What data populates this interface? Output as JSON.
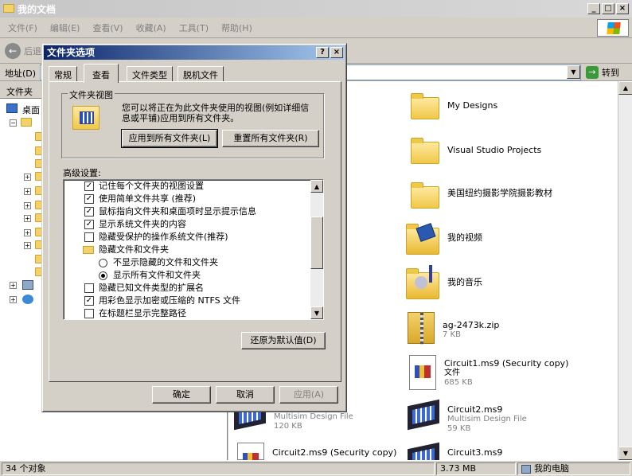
{
  "window": {
    "title": "我的文档"
  },
  "menu": [
    "文件(F)",
    "编辑(E)",
    "查看(V)",
    "收藏(A)",
    "工具(T)",
    "帮助(H)"
  ],
  "toolbar": {
    "back_label": "后退"
  },
  "address": {
    "label": "地址(D)",
    "go_label": "转到"
  },
  "folder_pane": {
    "title": "文件夹",
    "desktop_label": "桌面"
  },
  "files": [
    {
      "name": "My Designs",
      "type": "folder"
    },
    {
      "name": "Visual Studio Projects",
      "type": "folder"
    },
    {
      "name": "美国纽约摄影学院摄影教材",
      "type": "folder"
    },
    {
      "name": "我的视频",
      "type": "video-folder"
    },
    {
      "name": "我的音乐",
      "type": "music-folder"
    },
    {
      "name": "ag-2473k.zip",
      "sub1": "7 KB",
      "type": "zip"
    },
    {
      "name": "Circuit1.ms9 (Security copy)",
      "sub1": "文件",
      "sub2": "685 KB",
      "type": "doc"
    },
    {
      "name": "Circuit2.ms9",
      "sub1": "Multisim Design File",
      "sub2": "59 KB",
      "type": "chip"
    },
    {
      "name": "Circuit3.ms9",
      "type": "chip"
    },
    {
      "name": "",
      "sub1": "Multisim Design File",
      "sub2": "120 KB",
      "type": "chip"
    },
    {
      "name": "Circuit2.ms9 (Security copy)",
      "type": "doc"
    }
  ],
  "status": {
    "count": "34 个对象",
    "size": "3.73 MB",
    "location": "我的电脑"
  },
  "dialog": {
    "title": "文件夹选项",
    "tabs": [
      "常规",
      "查看",
      "文件类型",
      "脱机文件"
    ],
    "active_tab": "查看",
    "group_title": "文件夹视图",
    "group_text": "您可以将正在为此文件夹使用的视图(例如详细信息或平铺)应用到所有文件夹。",
    "apply_all_button": "应用到所有文件夹(L)",
    "reset_all_button": "重置所有文件夹(R)",
    "advanced_label": "高级设置:",
    "settings": [
      {
        "label": "记住每个文件夹的视图设置",
        "kind": "checkbox",
        "checked": true,
        "indent": 0
      },
      {
        "label": "使用简单文件共享 (推荐)",
        "kind": "checkbox",
        "checked": true,
        "indent": 0
      },
      {
        "label": "鼠标指向文件夹和桌面项时显示提示信息",
        "kind": "checkbox",
        "checked": true,
        "indent": 0
      },
      {
        "label": "显示系统文件夹的内容",
        "kind": "checkbox",
        "checked": true,
        "indent": 0
      },
      {
        "label": "隐藏受保护的操作系统文件(推荐)",
        "kind": "checkbox",
        "checked": false,
        "indent": 0
      },
      {
        "label": "隐藏文件和文件夹",
        "kind": "folder",
        "indent": 0
      },
      {
        "label": "不显示隐藏的文件和文件夹",
        "kind": "radio",
        "checked": false,
        "indent": 1
      },
      {
        "label": "显示所有文件和文件夹",
        "kind": "radio",
        "checked": true,
        "indent": 1
      },
      {
        "label": "隐藏已知文件类型的扩展名",
        "kind": "checkbox",
        "checked": false,
        "indent": 0
      },
      {
        "label": "用彩色显示加密或压缩的 NTFS 文件",
        "kind": "checkbox",
        "checked": true,
        "indent": 0
      },
      {
        "label": "在标题栏显示完整路径",
        "kind": "checkbox",
        "checked": false,
        "indent": 0
      }
    ],
    "restore_defaults_button": "还原为默认值(D)",
    "ok_button": "确定",
    "cancel_button": "取消",
    "apply_button": "应用(A)"
  }
}
